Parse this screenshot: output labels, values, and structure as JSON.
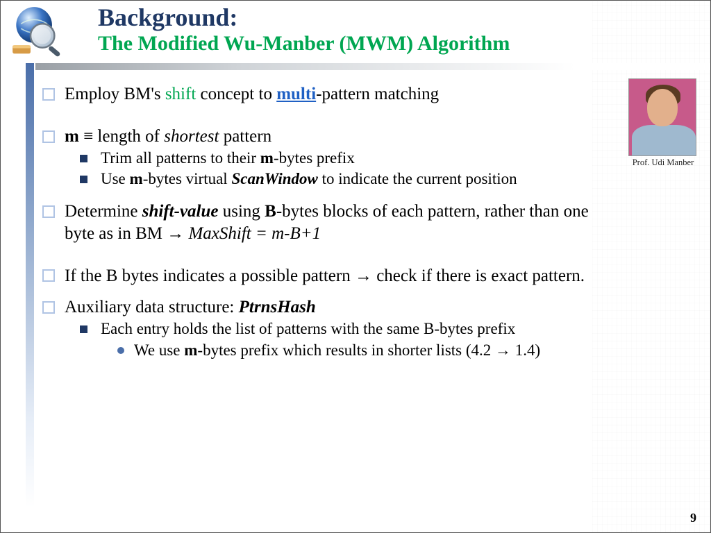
{
  "header": {
    "title_top": "Background:",
    "title_sub": "The Modified Wu-Manber (MWM) Algorithm"
  },
  "photo": {
    "caption": "Prof. Udi Manber"
  },
  "bullets": {
    "b1_pre": "Employ BM's ",
    "b1_shift": "shift",
    "b1_mid": " concept to ",
    "b1_multi": "multi",
    "b1_post": "-pattern matching",
    "b2_m": "m",
    "b2_eq": " ≡ length of ",
    "b2_shortest": "shortest",
    "b2_post": " pattern",
    "b2a_pre": "Trim all patterns to their ",
    "b2a_m": "m",
    "b2a_post": "-bytes prefix",
    "b2b_pre": "Use ",
    "b2b_m": "m",
    "b2b_mid": "-bytes virtual ",
    "b2b_sw": "ScanWindow",
    "b2b_post": "  to indicate the current position",
    "b3_pre": "Determine ",
    "b3_sv": "shift-value",
    "b3_mid1": " using ",
    "b3_B": "B",
    "b3_mid2": "-bytes blocks of each pattern, rather than one byte as in BM  ",
    "b3_arrow": "→",
    "b3_sp": " ",
    "b3_ms": "MaxShift = m-B+1",
    "b4_pre": "If the B bytes indicates a possible pattern ",
    "b4_arrow": "→",
    "b4_post": " check if there is exact pattern.",
    "b5_pre": "Auxiliary data structure: ",
    "b5_ph": "PtrnsHash",
    "b5a": "Each entry holds the list of patterns with the same B-bytes prefix",
    "b5a1_pre": "We use ",
    "b5a1_m": "m",
    "b5a1_mid": "-bytes prefix which results in shorter lists (4.2 ",
    "b5a1_arrow": "→",
    "b5a1_post": " 1.4)"
  },
  "slide_number": "9"
}
